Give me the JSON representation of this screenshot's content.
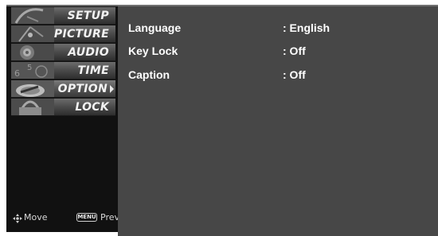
{
  "menu": {
    "items": [
      {
        "label": "SETUP",
        "icon": "satellite-dish-icon"
      },
      {
        "label": "PICTURE",
        "icon": "antenna-icon"
      },
      {
        "label": "AUDIO",
        "icon": "speaker-icon"
      },
      {
        "label": "TIME",
        "icon": "clock-icon"
      },
      {
        "label": "OPTION",
        "icon": "option-disc-icon",
        "selected": true
      },
      {
        "label": "LOCK",
        "icon": "padlock-icon"
      }
    ]
  },
  "hints": {
    "move": "Move",
    "menu_key": "MENU",
    "prev": "Prev"
  },
  "options": [
    {
      "name": "Language",
      "value": ": English"
    },
    {
      "name": "Key Lock",
      "value": ": Off"
    },
    {
      "name": "Caption",
      "value": ": Off"
    }
  ],
  "colors": {
    "left_panel": "#111111",
    "right_panel": "#474747",
    "text": "#ffffff"
  }
}
